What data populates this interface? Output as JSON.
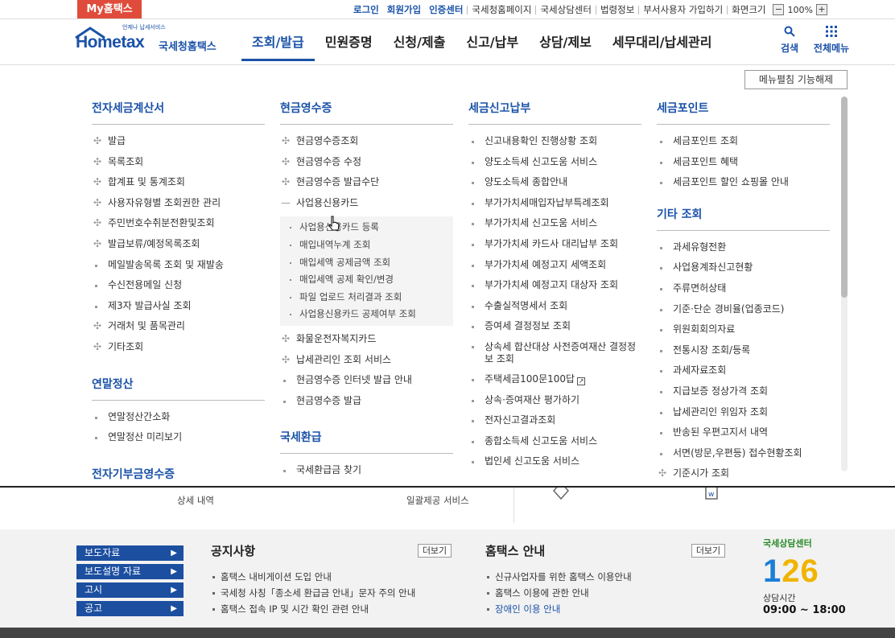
{
  "topbar": {
    "myhometax": "My홈택스",
    "links": [
      "로그인",
      "회원가입",
      "인증센터",
      "국세청홈페이지",
      "국세상담센터",
      "법령정보",
      "부서사용자 가입하기",
      "화면크기"
    ],
    "zoom_minus": "−",
    "zoom_value": "100%",
    "zoom_plus": "+"
  },
  "logo": {
    "tagline": "언제나 납세서비스",
    "brand": "Hometax",
    "name": "국세청홈택스"
  },
  "mainmenu": [
    "조회/발급",
    "민원증명",
    "신청/제출",
    "신고/납부",
    "상담/제보",
    "세무대리/납세관리"
  ],
  "rightmenu": {
    "search": "검색",
    "allmenu": "전체메뉴"
  },
  "panel": {
    "unlock_button": "메뉴펼침 기능해제",
    "col1": {
      "title": "전자세금계산서",
      "items": [
        "발급",
        "목록조회",
        "합계표 및 통계조회",
        "사용자유형별 조회권한 관리",
        "주민번호수취분전환및조회",
        "발급보류/예정목록조회",
        "메일발송목록 조회 및 재발송",
        "수신전용메일 신청",
        "제3자 발급사실 조회",
        "거래처 및 품목관리",
        "기타조회"
      ],
      "title2": "연말정산",
      "items2": [
        "연말정산간소화",
        "연말정산 미리보기"
      ],
      "title3": "전자기부금영수증"
    },
    "col2": {
      "title": "현금영수증",
      "items": [
        "현금영수증조회",
        "현금영수증 수정",
        "현금영수증 발급수단",
        "사업용신용카드"
      ],
      "subitems": [
        "사업용신용카드 등록",
        "매입내역누계 조회",
        "매입세액 공제금액 조회",
        "매입세액 공제 확인/변경",
        "파일 업로드 처리결과 조회",
        "사업용신용카드 공제여부 조회"
      ],
      "items_after": [
        "화물운전자복지카드",
        "납세관리인 조회 서비스",
        "현금영수증 인터넷 발급 안내",
        "현금영수증 발급"
      ],
      "title2": "국세환급",
      "items2": [
        "국세환급금 찾기"
      ]
    },
    "col3": {
      "title": "세금신고납부",
      "items": [
        "신고내용확인 진행상황 조회",
        "양도소득세 신고도움 서비스",
        "양도소득세 종합안내",
        "부가가치세매입자납부특례조회",
        "부가가치세 신고도움 서비스",
        "부가가치세 카드사 대리납부 조회",
        "부가가치세 예정고지 세액조회",
        "부가가치세 예정고지 대상자 조회",
        "수출실적명세서 조회",
        "증여세 결정정보 조회",
        "상속세 합산대상 사전증여재산 결정정보 조회",
        "주택세금100문100답",
        "상속·증여재산 평가하기",
        "전자신고결과조회",
        "종합소득세 신고도움 서비스",
        "법인세 신고도움 서비스"
      ]
    },
    "col4": {
      "title": "세금포인트",
      "items": [
        "세금포인트 조회",
        "세금포인트 혜택",
        "세금포인트 할인 쇼핑몰 안내"
      ],
      "title2": "기타 조회",
      "items2": [
        "과세유형전환",
        "사업용계좌신고현황",
        "주류면허상태",
        "기준·단순 경비율(업종코드)",
        "위원회회의자료",
        "전통시장 조회/등록",
        "과세자료조회",
        "지급보증 정상가격 조회",
        "납세관리인 위임자 조회",
        "반송된 우편고지서 내역",
        "서면(방문,우편등) 접수현황조회",
        "기준시가 조회"
      ]
    }
  },
  "strip": [
    "상세 내역",
    "일괄제공 서비스"
  ],
  "footer": {
    "buttons": [
      "보도자료",
      "보도설명 자료",
      "고시",
      "공고"
    ],
    "notice_title": "공지사항",
    "notice_more": "더보기",
    "notices": [
      "홈택스 내비게이션 도입 안내",
      "국세청 사칭「종소세 환급금 안내」문자 주의 안내",
      "홈택스 접속 IP 및 시간 확인 관련 안내"
    ],
    "guide_title": "홈택스 안내",
    "guide_more": "더보기",
    "guides": [
      "신규사업자를 위한 홈택스 이용안내",
      "홈택스 이용에 관한 안내",
      "장애인 이용 안내"
    ],
    "callcenter": {
      "label": "국세상담센터",
      "number_a": "1",
      "number_b": "26",
      "hours_label": "상담시간",
      "hours": "09:00 ~ 18:00"
    }
  }
}
